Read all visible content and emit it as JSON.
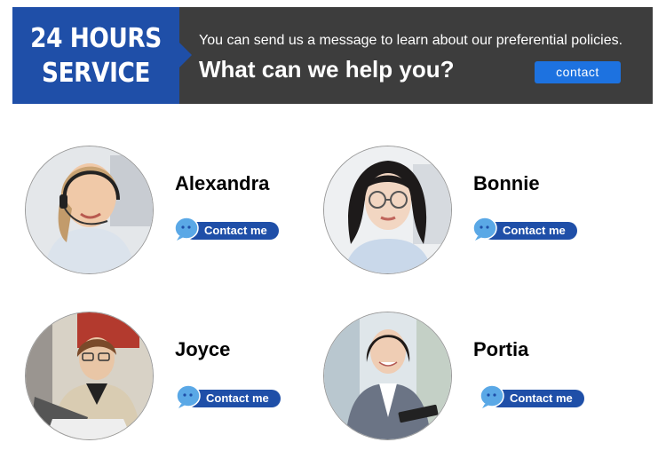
{
  "banner": {
    "badge_line1": "24 HOURS",
    "badge_line2": "SERVICE",
    "subtitle": "You can send us a message to learn about our preferential policies.",
    "title": "What can we help you?",
    "contact_label": "contact"
  },
  "colors": {
    "badge_blue": "#1f4fa8",
    "banner_dark": "#3d3d3d",
    "button_blue": "#1d72e0",
    "bubble_blue": "#5aa8e6"
  },
  "agents": [
    {
      "name": "Alexandra",
      "button": "Contact me",
      "photo": "agent-photo-headset"
    },
    {
      "name": "Bonnie",
      "button": "Contact me",
      "photo": "agent-photo-glasses"
    },
    {
      "name": "Joyce",
      "button": "Contact me",
      "photo": "agent-photo-laptop"
    },
    {
      "name": "Portia",
      "button": "Contact me",
      "photo": "agent-photo-suit"
    }
  ]
}
